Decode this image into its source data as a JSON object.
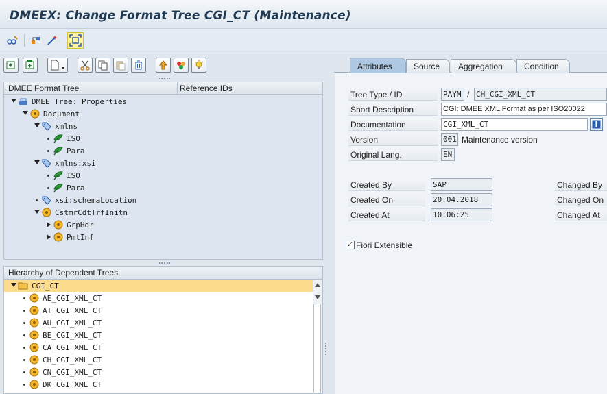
{
  "title": "DMEEX: Change Format Tree CGI_CT (Maintenance)",
  "toolbar": {
    "icons": [
      "glasses-pencil-icon",
      "hierarchy-icon",
      "magic-wand-icon",
      "fullscreen-icon"
    ],
    "highlight": "fullscreen-icon"
  },
  "tree_toolbar": {
    "icons": [
      "insert-node-icon",
      "insert-subnode-icon",
      "new-document-icon",
      "cut-icon",
      "copy-icon",
      "paste-icon",
      "delete-icon",
      "move-up-icon",
      "check-icon",
      "lightbulb-icon"
    ]
  },
  "format_tree": {
    "col1": "DMEE Format Tree",
    "col2": "Reference IDs",
    "nodes": [
      {
        "label": "DMEE Tree: Properties",
        "level": 0,
        "toggle": "down",
        "icon": "tree-icon"
      },
      {
        "label": "Document",
        "level": 1,
        "toggle": "down",
        "icon": "node-icon"
      },
      {
        "label": "xmlns",
        "level": 2,
        "toggle": "down",
        "icon": "tag-icon"
      },
      {
        "label": "ISO",
        "level": 3,
        "toggle": "dot",
        "icon": "leaf-icon"
      },
      {
        "label": "Para",
        "level": 3,
        "toggle": "dot",
        "icon": "leaf-icon"
      },
      {
        "label": "xmlns:xsi",
        "level": 2,
        "toggle": "down",
        "icon": "tag-icon"
      },
      {
        "label": "ISO",
        "level": 3,
        "toggle": "dot",
        "icon": "leaf-icon"
      },
      {
        "label": "Para",
        "level": 3,
        "toggle": "dot",
        "icon": "leaf-icon"
      },
      {
        "label": "xsi:schemaLocation",
        "level": 2,
        "toggle": "dot",
        "icon": "tag-icon"
      },
      {
        "label": "CstmrCdtTrfInitn",
        "level": 2,
        "toggle": "down",
        "icon": "node-icon"
      },
      {
        "label": "GrpHdr",
        "level": 3,
        "toggle": "right",
        "icon": "node-icon"
      },
      {
        "label": "PmtInf",
        "level": 3,
        "toggle": "right",
        "icon": "node-icon"
      }
    ]
  },
  "dependent_trees": {
    "header": "Hierarchy of Dependent Trees",
    "root": "CGI_CT",
    "items": [
      "AE_CGI_XML_CT",
      "AT_CGI_XML_CT",
      "AU_CGI_XML_CT",
      "BE_CGI_XML_CT",
      "CA_CGI_XML_CT",
      "CH_CGI_XML_CT",
      "CN_CGI_XML_CT",
      "DK_CGI_XML_CT"
    ]
  },
  "tabs": [
    "Attributes",
    "Source",
    "Aggregation",
    "Condition"
  ],
  "attributes": {
    "tree_type_label": "Tree Type / ID",
    "tree_type": "PAYM",
    "slash": "/",
    "tree_id": "CH_CGI_XML_CT",
    "short_desc_label": "Short Description",
    "short_desc": "CGI: DMEE XML Format as per ISO20022",
    "doc_label": "Documentation",
    "doc": "CGI_XML_CT",
    "version_label": "Version",
    "version": "001",
    "version_text": "Maintenance version",
    "lang_label": "Original Lang.",
    "lang": "EN",
    "created_by_label": "Created By",
    "created_by": "SAP",
    "created_on_label": "Created On",
    "created_on": "20.04.2018",
    "created_at_label": "Created At",
    "created_at": "10:06:25",
    "changed_by_label": "Changed By",
    "changed_on_label": "Changed On",
    "changed_at_label": "Changed At",
    "fiori_label": "Fiori Extensible",
    "fiori_checked": true
  }
}
